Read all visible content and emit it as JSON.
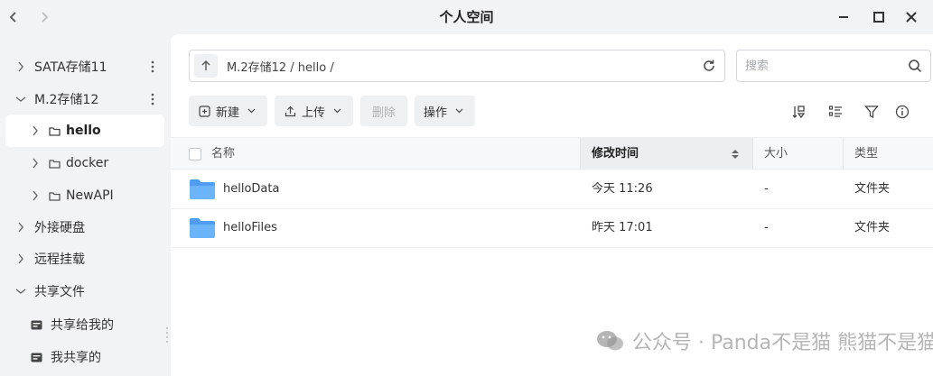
{
  "window": {
    "title": "个人空间"
  },
  "sidebar": {
    "items": [
      {
        "label": "SATA存储11"
      },
      {
        "label": "M.2存储12"
      },
      {
        "label": "hello"
      },
      {
        "label": "docker"
      },
      {
        "label": "NewAPI"
      },
      {
        "label": "外接硬盘"
      },
      {
        "label": "远程挂载"
      },
      {
        "label": "共享文件"
      },
      {
        "label": "共享给我的"
      },
      {
        "label": "我共享的"
      }
    ]
  },
  "pathbar": {
    "path": "M.2存储12 / hello /"
  },
  "search": {
    "placeholder": "搜索"
  },
  "toolbar": {
    "new_label": "新建",
    "upload_label": "上传",
    "delete_label": "删除",
    "actions_label": "操作"
  },
  "table": {
    "columns": {
      "name": "名称",
      "modified": "修改时间",
      "size": "大小",
      "type": "类型"
    },
    "rows": [
      {
        "name": "helloData",
        "modified": "今天 11:26",
        "size": "-",
        "type": "文件夹"
      },
      {
        "name": "helloFiles",
        "modified": "昨天 17:01",
        "size": "-",
        "type": "文件夹"
      }
    ]
  },
  "watermark": {
    "text": "公众号 · Panda不是猫 熊猫不是猫猫"
  },
  "colors": {
    "folder": "#5aa7f5",
    "sidebar_bg": "#f2f3f5",
    "panel_bg": "#ffffff",
    "button_bg": "#eff0f2"
  }
}
